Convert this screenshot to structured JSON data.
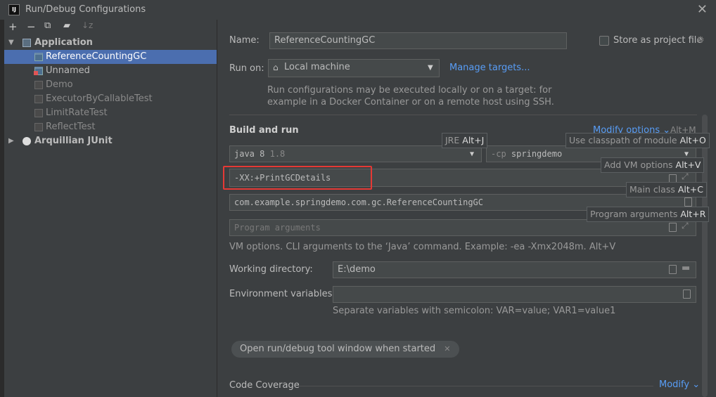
{
  "window": {
    "title": "Run/Debug Configurations",
    "app_icon_text": "IJ"
  },
  "sidebar": {
    "toolbar": [
      "add-icon",
      "remove-icon",
      "copy-icon",
      "folder-icon",
      "sort-icon"
    ],
    "groups": [
      {
        "label": "Application",
        "expanded": true,
        "items": [
          "ReferenceCountingGC",
          "Unnamed",
          "Demo",
          "ExecutorByCallableTest",
          "LimitRateTest",
          "ReflectTest"
        ]
      },
      {
        "label": "Arquillian JUnit",
        "expanded": false,
        "items": []
      }
    ]
  },
  "form": {
    "name_label": "Name:",
    "name_value": "ReferenceCountingGC",
    "store_label": "Store as project file",
    "run_on_label": "Run on:",
    "run_on_value": "Local machine",
    "manage_targets": "Manage targets...",
    "run_on_hint_1": "Run configurations may be executed locally or on a target: for",
    "run_on_hint_2": "example in a Docker Container or on a remote host using SSH.",
    "build_run_title": "Build and run",
    "modify_options": "Modify options",
    "modify_options_shortcut": "Alt+M",
    "jre_value": "java 8",
    "jre_version": "1.8",
    "cp_prefix": "-cp",
    "cp_value": "springdemo",
    "vm_options_value": "-XX:+PrintGCDetails",
    "main_class_value": "com.example.springdemo.com.gc.ReferenceCountingGC",
    "program_args_placeholder": "Program arguments",
    "vm_hint": "VM options. CLI arguments to the ‘Java’ command. Example: -ea -Xmx2048m. Alt+V",
    "working_dir_label": "Working directory:",
    "working_dir_value": "E:\\demo",
    "env_label": "Environment variables:",
    "env_hint": "Separate variables with semicolon: VAR=value; VAR1=value1",
    "open_tool_window": "Open run/debug tool window when started",
    "code_coverage": "Code Coverage",
    "modify": "Modify"
  },
  "tooltips": {
    "jre": {
      "text": "JRE",
      "key": "Alt+J"
    },
    "classpath": {
      "text": "Use classpath of module",
      "key": "Alt+O"
    },
    "vm": {
      "text": "Add VM options",
      "key": "Alt+V"
    },
    "main_class": {
      "text": "Main class",
      "key": "Alt+C"
    },
    "program_args": {
      "text": "Program arguments",
      "key": "Alt+R"
    }
  },
  "colors": {
    "accent_link": "#589df6",
    "selection": "#4b6eaf",
    "highlight": "#e53935"
  }
}
